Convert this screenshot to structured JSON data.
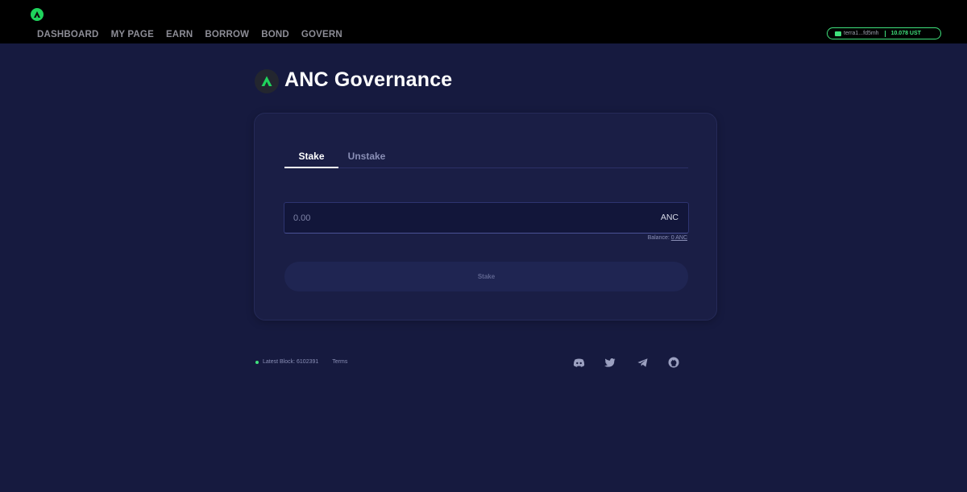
{
  "header": {
    "logo": "anchor-logo-icon",
    "nav": [
      "DASHBOARD",
      "MY PAGE",
      "EARN",
      "BORROW",
      "BOND",
      "GOVERN"
    ],
    "wallet": {
      "address": "terra1...fd5mh",
      "balance": "10.078 UST"
    }
  },
  "page": {
    "title": "ANC Governance"
  },
  "card": {
    "tabs": [
      "Stake",
      "Unstake"
    ],
    "active_tab": "Stake",
    "amount": {
      "placeholder": "0.00",
      "value": "",
      "unit": "ANC"
    },
    "balance": {
      "label": "Balance:",
      "value": "0 ANC"
    },
    "submit_label": "Stake"
  },
  "footer": {
    "block_label": "Latest Block: 6102391",
    "terms": "Terms",
    "icons": [
      "discord-icon",
      "twitter-icon",
      "telegram-icon",
      "github-icon",
      "theme-moon-icon"
    ]
  },
  "colors": {
    "background": "#161a3f",
    "header": "#000000",
    "accent": "#3fe27c",
    "card": "#1a1e45"
  }
}
